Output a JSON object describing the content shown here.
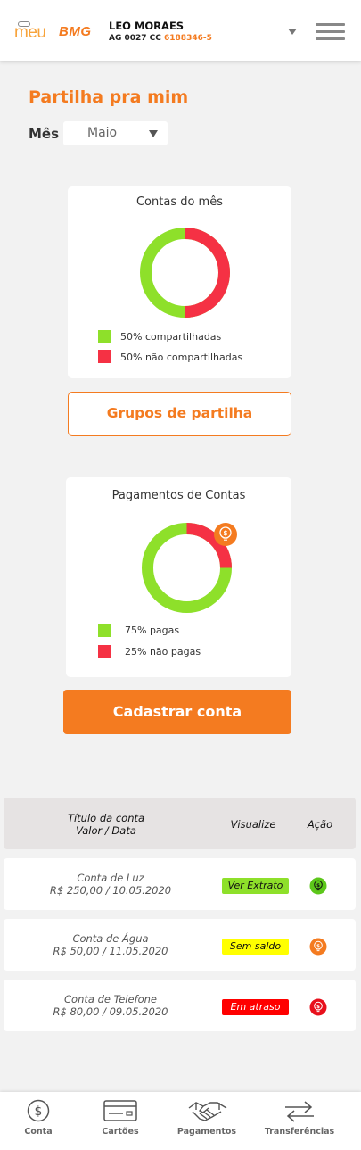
{
  "header": {
    "logo_meu": "meu",
    "logo_bmg": "BMG",
    "user_name": "LEO MORAES",
    "agency_prefix": "AG 0027 CC ",
    "account_number": "6188346-5",
    "icons": {
      "dropdown": "chevron-down-icon",
      "menu": "hamburger-menu-icon"
    }
  },
  "page_title": "Partilha pra mim",
  "month_filter": {
    "label": "Mês",
    "selected": "Maio"
  },
  "accounts_card": {
    "title": "Contas do mês",
    "shared_fraction": 0.5,
    "legend": [
      {
        "label": "50% compartilhadas",
        "color": "#8ee02a"
      },
      {
        "label": "50% não compartilhadas",
        "color": "#f53144"
      }
    ]
  },
  "groups_button": "Grupos de partilha",
  "payments_card": {
    "title": "Pagamentos de Contas",
    "paid_fraction": 0.75,
    "legend": [
      {
        "label": "75% pagas",
        "color": "#8ee02a"
      },
      {
        "label": "25% não pagas",
        "color": "#f53144"
      }
    ],
    "badge_icon": "money-bulb-icon"
  },
  "register_button": "Cadastrar conta",
  "table": {
    "headers": {
      "title_line1": "Título da conta",
      "title_line2": "Valor / Data",
      "view": "Visualize",
      "action": "Ação"
    },
    "rows": [
      {
        "name": "Conta de Luz",
        "detail": "R$ 250,00 / 10.05.2020",
        "status": "Ver Extrato",
        "status_bg": "#8ee02a",
        "status_fg": "#111111",
        "icon_color": "#5cc71a"
      },
      {
        "name": "Conta de Água",
        "detail": "R$ 50,00 / 11.05.2020",
        "status": "Sem saldo",
        "status_bg": "#ffff00",
        "status_fg": "#111111",
        "icon_color": "#f47b20"
      },
      {
        "name": "Conta de Telefone",
        "detail": "R$ 80,00 / 09.05.2020",
        "status": "Em atraso",
        "status_bg": "#ff0000",
        "status_fg": "#ffffff",
        "icon_color": "#e8101c"
      }
    ]
  },
  "bottom_nav": [
    {
      "label": "Conta",
      "icon": "dollar-coin-icon"
    },
    {
      "label": "Cartões",
      "icon": "credit-card-icon"
    },
    {
      "label": "Pagamentos",
      "icon": "handshake-icon"
    },
    {
      "label": "Transferências",
      "icon": "transfer-arrows-icon"
    }
  ],
  "colors": {
    "brand": "#f47b20",
    "green": "#8ee02a",
    "red": "#f53144"
  }
}
